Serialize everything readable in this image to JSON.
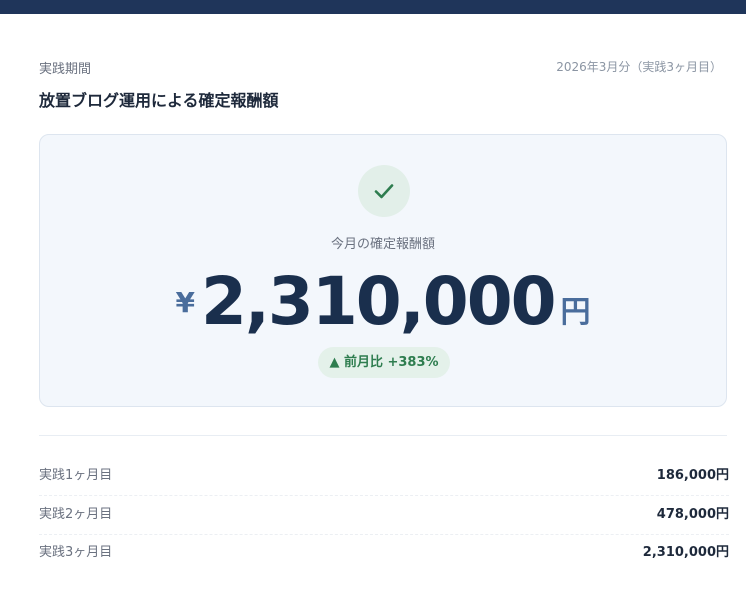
{
  "header": {
    "section_label": "実践期間",
    "period": "2026年3月分（実践3ヶ月目）",
    "title": "放置ブログ運用による確定報酬額"
  },
  "card": {
    "label": "今月の確定報酬額",
    "currency_symbol": "¥",
    "amount": "2,310,000",
    "unit": "円",
    "badge": "▲ 前月比 +383%"
  },
  "history": [
    {
      "label": "実践1ヶ月目",
      "value": "186,000円"
    },
    {
      "label": "実践2ヶ月目",
      "value": "478,000円"
    },
    {
      "label": "実践3ヶ月目",
      "value": "2,310,000円"
    }
  ],
  "colors": {
    "top_bar": "#1f355a",
    "accent_green": "#2e7d4f",
    "amount": "#1a2f4d"
  },
  "icons": {
    "check": "check-icon"
  }
}
